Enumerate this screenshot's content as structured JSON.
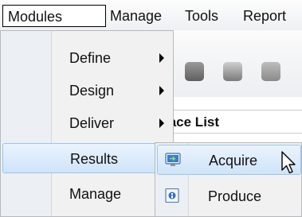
{
  "menubar": {
    "items": [
      {
        "label": "Modules"
      },
      {
        "label": "Manage"
      },
      {
        "label": "Tools"
      },
      {
        "label": "Report"
      }
    ]
  },
  "modules_menu": {
    "items": [
      {
        "label": "Define",
        "has_submenu": true
      },
      {
        "label": "Design",
        "has_submenu": true
      },
      {
        "label": "Deliver",
        "has_submenu": true
      },
      {
        "label": "Results",
        "has_submenu": true,
        "highlighted": true
      },
      {
        "label": "Manage",
        "has_submenu": true
      }
    ]
  },
  "results_submenu": {
    "items": [
      {
        "label": "Acquire",
        "icon": "acquire-icon",
        "highlighted": true
      },
      {
        "label": "Produce",
        "icon": "produce-icon"
      }
    ]
  },
  "background": {
    "panel_title": "lace List"
  },
  "colors": {
    "highlight_fill": "#cfe4fa",
    "highlight_border": "#9cc4ee",
    "menu_bg": "#f1f1f1"
  }
}
